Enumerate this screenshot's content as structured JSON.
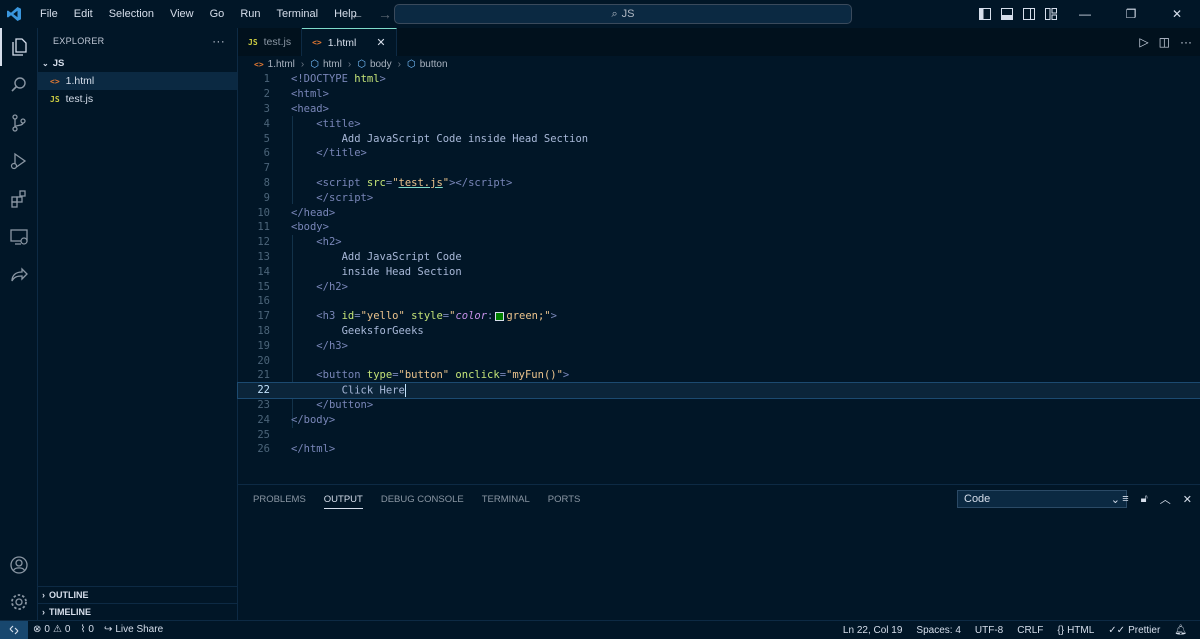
{
  "menu": [
    "File",
    "Edit",
    "Selection",
    "View",
    "Go",
    "Run",
    "Terminal",
    "Help"
  ],
  "search": {
    "label": "JS"
  },
  "explorer": {
    "title": "EXPLORER",
    "folder": "JS",
    "files": [
      {
        "name": "1.html",
        "icon": "<>",
        "icon_color": "#e37933",
        "selected": true
      },
      {
        "name": "test.js",
        "icon": "JS",
        "icon_color": "#cbcb41",
        "selected": false
      }
    ],
    "outline": "OUTLINE",
    "timeline": "TIMELINE"
  },
  "tabs": [
    {
      "name": "test.js",
      "icon": "JS",
      "icon_color": "#cbcb41",
      "active": false
    },
    {
      "name": "1.html",
      "icon": "<>",
      "icon_color": "#e37933",
      "active": true
    }
  ],
  "breadcrumb": [
    "1.html",
    "html",
    "body",
    "button"
  ],
  "editor": {
    "current_line": 22,
    "line_numbers": [
      "1",
      "2",
      "3",
      "4",
      "5",
      "6",
      "7",
      "8",
      "9",
      "10",
      "11",
      "12",
      "13",
      "14",
      "15",
      "16",
      "17",
      "18",
      "19",
      "20",
      "21",
      "22",
      "23",
      "24",
      "25",
      "26"
    ]
  },
  "panel": {
    "tabs": [
      "PROBLEMS",
      "OUTPUT",
      "DEBUG CONSOLE",
      "TERMINAL",
      "PORTS"
    ],
    "active_tab": "OUTPUT",
    "select_value": "Code"
  },
  "status": {
    "errors": "0",
    "warnings": "0",
    "ports": "0",
    "live_share": "Live Share",
    "position": "Ln 22, Col 19",
    "spaces": "Spaces: 4",
    "encoding": "UTF-8",
    "eol": "CRLF",
    "language": "HTML",
    "prettier": "Prettier"
  },
  "colors": {
    "background": "#011627",
    "accent": "#7fdbca",
    "selection": "#0b253a"
  }
}
